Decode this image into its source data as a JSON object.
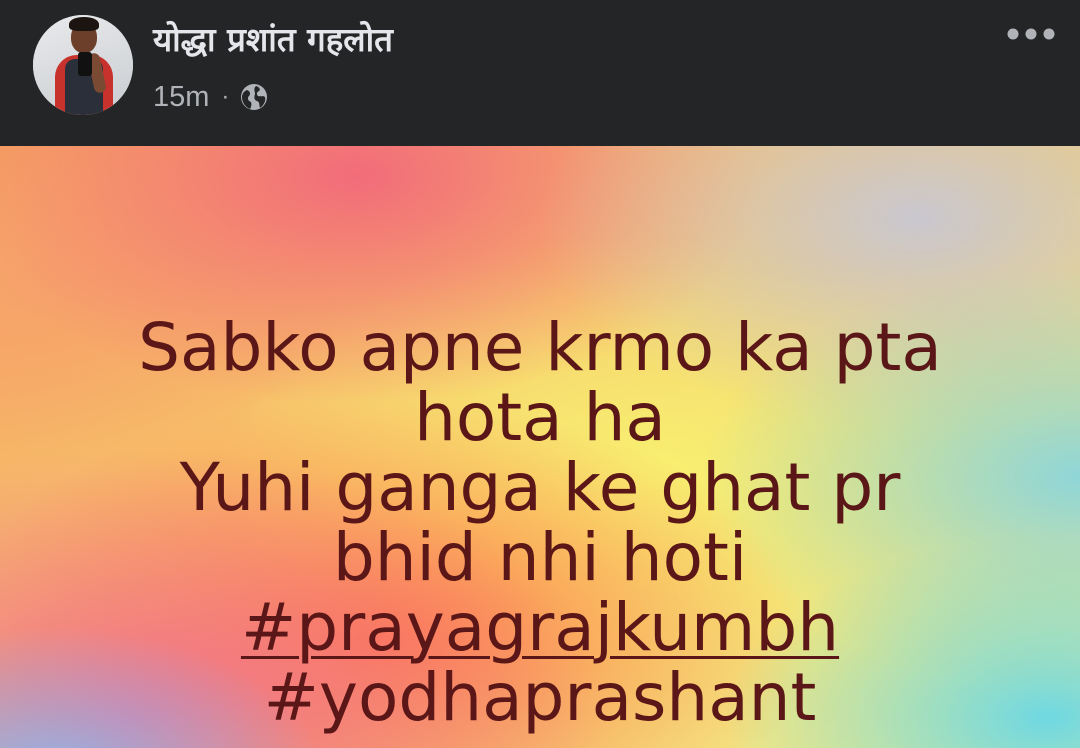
{
  "post": {
    "author_name": "योद्धा प्रशांत गहलोत",
    "timestamp": "15m",
    "separator": "·",
    "privacy_icon": "globe-icon",
    "more_icon": "more-options-icon",
    "avatar_icon": "profile-photo"
  },
  "quote": {
    "lines": [
      "Sabko apne krmo ka pta",
      "hota ha",
      "Yuhi ganga ke ghat pr",
      "bhid nhi hoti"
    ],
    "hashtags": [
      "#prayagrajkumbh",
      "#yodhaprashant"
    ]
  },
  "colors": {
    "header_bg": "#242526",
    "header_text": "#e4e6eb",
    "meta_text": "#b0b3b8",
    "quote_text": "#5b1717"
  }
}
